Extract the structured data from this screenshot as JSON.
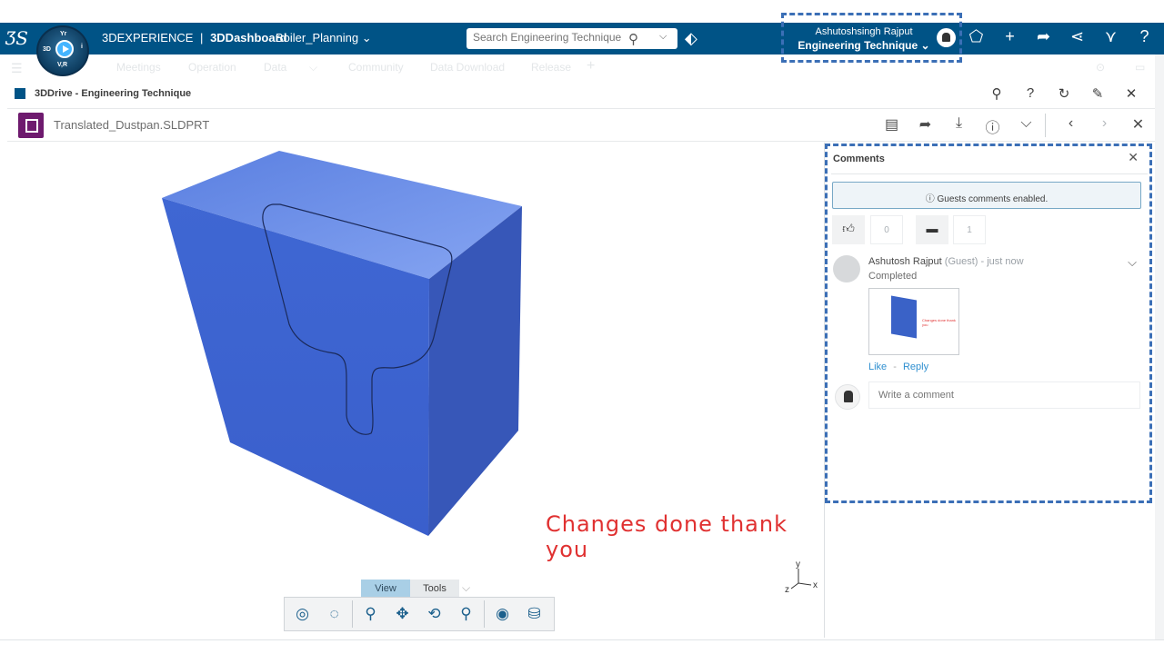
{
  "topbar": {
    "brand_prefix": "3DEXPERIENCE",
    "brand_separator": "|",
    "brand_app": "3DDashboard",
    "dashboard_name": "Boiler_Planning",
    "dashboard_caret": "⌄",
    "compass_labels": {
      "top": "V,R",
      "left": "3D",
      "right": "i",
      "bottom": "V,R",
      "tl": "Yr"
    },
    "search_placeholder": "Search Engineering Technique",
    "search_icon": "search-icon",
    "user_name": "Ashutoshsingh Rajput",
    "user_role": "Engineering Technique",
    "user_role_caret": "⌄",
    "icons": [
      "tag-icon",
      "label-icon",
      "plus-icon",
      "share-icon",
      "network-icon",
      "compass-tools-icon",
      "help-icon"
    ]
  },
  "tabs": [
    "Meetings",
    "Operation",
    "Data",
    "Community",
    "Data Download",
    "Release"
  ],
  "app": {
    "title": "3DDrive - Engineering Technique",
    "tool_icons": [
      "search-icon",
      "help-icon",
      "refresh-icon",
      "pin-icon",
      "close-icon"
    ]
  },
  "file": {
    "name": "Translated_Dustpan.SLDPRT",
    "tool_icons": [
      "comment-icon",
      "share-icon",
      "download-icon",
      "info-icon",
      "chevron-down-icon"
    ],
    "nav_icons": [
      "prev-icon",
      "next-icon",
      "close-icon"
    ]
  },
  "viewer": {
    "caption": "Changes done thank you",
    "model_color": "#3a62c7",
    "axis": {
      "x": "x",
      "y": "y",
      "z": "z"
    },
    "toolbar_tabs": {
      "view": "View",
      "tools": "Tools"
    },
    "toolbar_icons": [
      "fit-all-icon",
      "add-annotation-icon",
      "zoom-icon",
      "pan-icon",
      "rotate-icon",
      "zoom-area-icon",
      "view-mode-icon",
      "render-mode-icon"
    ]
  },
  "comments": {
    "title": "Comments",
    "guest_notice": "Guests comments enabled.",
    "likes": "0",
    "comment_count": "1",
    "entries": [
      {
        "author": "Ashutosh Rajput",
        "meta": "(Guest) - just now",
        "text": "Completed",
        "like_label": "Like",
        "separator": "-",
        "reply_label": "Reply"
      }
    ],
    "write_placeholder": "Write a comment"
  },
  "colors": {
    "topbar": "#005386",
    "accent": "#3b6fb6",
    "caption": "#e03131",
    "link": "#2e8fd0"
  }
}
